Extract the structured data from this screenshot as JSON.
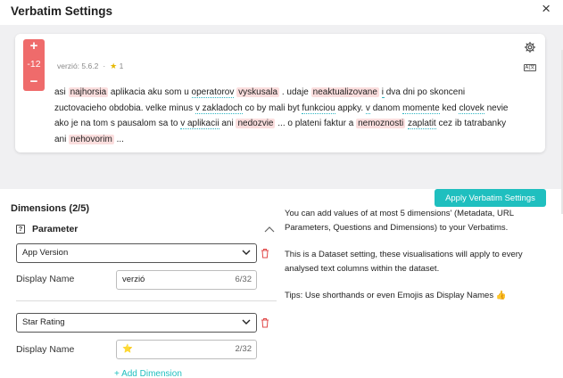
{
  "modal": {
    "title": "Verbatim Settings",
    "close_glyph": "×"
  },
  "preview": {
    "vote_plus": "+",
    "vote_count": "-12",
    "vote_minus": "−",
    "meta_version": "verzió: 5.6.2",
    "meta_sep": "·",
    "meta_star": "★",
    "meta_rating": "1",
    "verbatim": {
      "line1": [
        {
          "t": "asi ",
          "s": ""
        },
        {
          "t": "najhorsia",
          "s": "hl"
        },
        {
          "t": " aplikacia aku som u ",
          "s": ""
        },
        {
          "t": "operatorov",
          "s": "ul"
        },
        {
          "t": " ",
          "s": ""
        },
        {
          "t": "vyskusala",
          "s": "hl"
        },
        {
          "t": " . udaje ",
          "s": ""
        },
        {
          "t": "neaktualizovane",
          "s": "hl"
        },
        {
          "t": " ",
          "s": ""
        },
        {
          "t": "i",
          "s": "ul"
        },
        {
          "t": " dva dni po skonceni",
          "s": ""
        }
      ],
      "line2": [
        {
          "t": "zuctovacieho obdobia. velke minus ",
          "s": ""
        },
        {
          "t": "v zakladoch",
          "s": "ul"
        },
        {
          "t": " co by mali byt ",
          "s": ""
        },
        {
          "t": "funkciou",
          "s": "ul"
        },
        {
          "t": " appky. ",
          "s": ""
        },
        {
          "t": "v",
          "s": "ul"
        },
        {
          "t": " danom ",
          "s": ""
        },
        {
          "t": "momente",
          "s": "ul"
        },
        {
          "t": " ked ",
          "s": ""
        },
        {
          "t": "clovek",
          "s": "ul"
        },
        {
          "t": " nevie",
          "s": ""
        }
      ],
      "line3": [
        {
          "t": "ako je na tom s pausalom sa to ",
          "s": ""
        },
        {
          "t": "v aplikacii",
          "s": "ul"
        },
        {
          "t": " ani ",
          "s": ""
        },
        {
          "t": "nedozvie",
          "s": "hl"
        },
        {
          "t": " ... o plateni faktur a ",
          "s": ""
        },
        {
          "t": "nemoznosti",
          "s": "hl"
        },
        {
          "t": " ",
          "s": ""
        },
        {
          "t": "zaplatit",
          "s": "ul"
        },
        {
          "t": " cez ib tatrabanky",
          "s": ""
        }
      ],
      "line4": [
        {
          "t": "ani ",
          "s": ""
        },
        {
          "t": "nehovorim",
          "s": "hl"
        },
        {
          "t": " ...",
          "s": ""
        }
      ]
    },
    "translate_label": "A|文"
  },
  "apply_button": "Apply Verbatim Settings",
  "dimensions": {
    "title": "Dimensions (2/5)",
    "help_glyph": "?",
    "group_label": "Parameter",
    "display_name_label": "Display Name",
    "items": [
      {
        "select": "App Version",
        "display_value": "verzió",
        "counter": "6/32"
      },
      {
        "select": "Star Rating",
        "display_value": "⭐",
        "counter": "2/32"
      }
    ],
    "add_label": "+ Add Dimension"
  },
  "info": {
    "p1": "You can add values of at most 5 dimensions' (Metadata, URL Parameters, Questions and Dimensions) to your Verbatims.",
    "p2": "This is a Dataset setting, these visualisations will apply to every analysed text columns within the dataset.",
    "p3": "Tips: Use shorthands or even Emojis as Display Names 👍"
  },
  "colors": {
    "accent": "#1fbfbf",
    "vote_bg": "#ef6b6b",
    "highlight": "#fbdede",
    "trash": "#e04848"
  }
}
